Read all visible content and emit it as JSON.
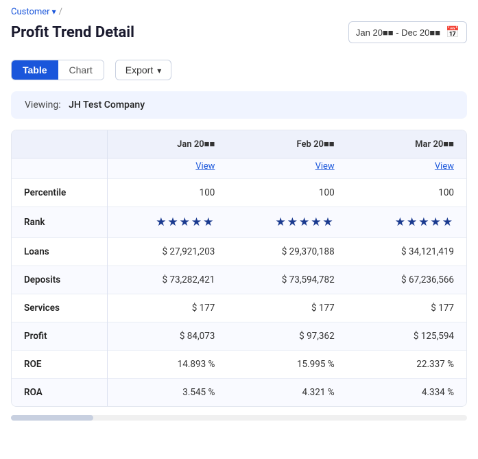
{
  "breadcrumb": {
    "customer_label": "Customer",
    "separator": "/"
  },
  "header": {
    "title": "Profit Trend Detail",
    "date_range": "Jan 20■■ - Dec 20■■"
  },
  "toolbar": {
    "tab_table": "Table",
    "tab_chart": "Chart",
    "export_label": "Export"
  },
  "viewing": {
    "label": "Viewing:",
    "company": "JH Test Company"
  },
  "table": {
    "columns": [
      {
        "label": "",
        "key": "name"
      },
      {
        "label": "Jan 20■■",
        "key": "jan"
      },
      {
        "label": "Feb 20■■",
        "key": "feb"
      },
      {
        "label": "Mar 20■■",
        "key": "mar"
      }
    ],
    "view_label": "View",
    "rows": [
      {
        "name": "Percentile",
        "jan": "100",
        "feb": "100",
        "mar": "100",
        "type": "text"
      },
      {
        "name": "Rank",
        "jan": "★★★★★",
        "feb": "★★★★★",
        "mar": "★★★★★",
        "type": "stars"
      },
      {
        "name": "Loans",
        "jan": "$ 27,921,203",
        "feb": "$ 29,370,188",
        "mar": "$ 34,121,419",
        "type": "text"
      },
      {
        "name": "Deposits",
        "jan": "$ 73,282,421",
        "feb": "$ 73,594,782",
        "mar": "$ 67,236,566",
        "type": "text"
      },
      {
        "name": "Services",
        "jan": "$ 177",
        "feb": "$ 177",
        "mar": "$ 177",
        "type": "text"
      },
      {
        "name": "Profit",
        "jan": "$ 84,073",
        "feb": "$ 97,362",
        "mar": "$ 125,594",
        "type": "text"
      },
      {
        "name": "ROE",
        "jan": "14.893 %",
        "feb": "15.995 %",
        "mar": "22.337 %",
        "type": "text"
      },
      {
        "name": "ROA",
        "jan": "3.545 %",
        "feb": "4.321 %",
        "mar": "4.334 %",
        "type": "text"
      }
    ]
  }
}
